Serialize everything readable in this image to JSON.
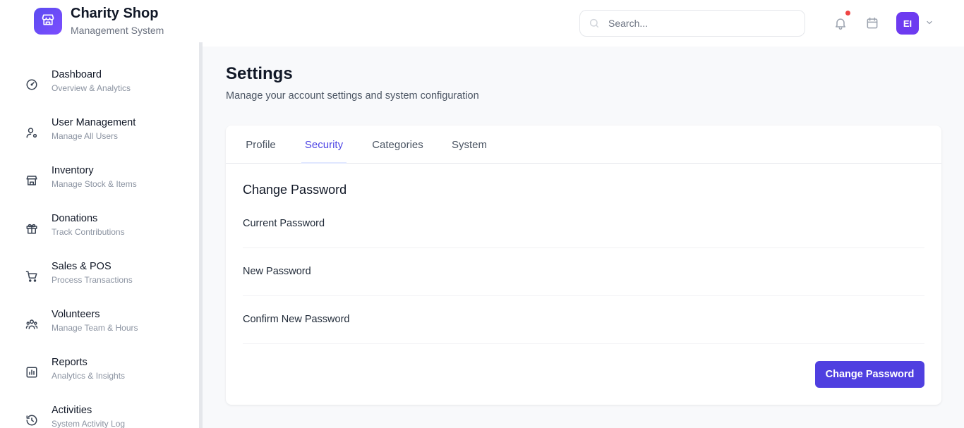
{
  "header": {
    "brand_title": "Charity Shop",
    "brand_subtitle": "Management System",
    "search_placeholder": "Search...",
    "avatar_initials": "EI",
    "logo_icon": "store-icon",
    "notification_icon": "bell-icon",
    "calendar_icon": "calendar-icon"
  },
  "sidebar": {
    "items": [
      {
        "title": "Dashboard",
        "subtitle": "Overview & Analytics",
        "icon": "gauge-icon"
      },
      {
        "title": "User Management",
        "subtitle": "Manage All Users",
        "icon": "user-cog-icon"
      },
      {
        "title": "Inventory",
        "subtitle": "Manage Stock & Items",
        "icon": "store-icon"
      },
      {
        "title": "Donations",
        "subtitle": "Track Contributions",
        "icon": "gift-icon"
      },
      {
        "title": "Sales & POS",
        "subtitle": "Process Transactions",
        "icon": "cart-icon"
      },
      {
        "title": "Volunteers",
        "subtitle": "Manage Team & Hours",
        "icon": "users-icon"
      },
      {
        "title": "Reports",
        "subtitle": "Analytics & Insights",
        "icon": "bar-chart-icon"
      },
      {
        "title": "Activities",
        "subtitle": "System Activity Log",
        "icon": "history-icon"
      }
    ]
  },
  "main": {
    "title": "Settings",
    "subtitle": "Manage your account settings and system configuration",
    "tabs": [
      {
        "label": "Profile"
      },
      {
        "label": "Security",
        "active": true
      },
      {
        "label": "Categories"
      },
      {
        "label": "System"
      }
    ],
    "section_title": "Change Password",
    "fields": [
      {
        "label": "Current Password",
        "value": ""
      },
      {
        "label": "New Password",
        "value": ""
      },
      {
        "label": "Confirm New Password",
        "value": ""
      }
    ],
    "submit_label": "Change Password"
  },
  "colors": {
    "accent": "#4f46e5",
    "button": "#4f3fe0",
    "avatar": "#6d3bf0",
    "notification_dot": "#ef4444"
  }
}
